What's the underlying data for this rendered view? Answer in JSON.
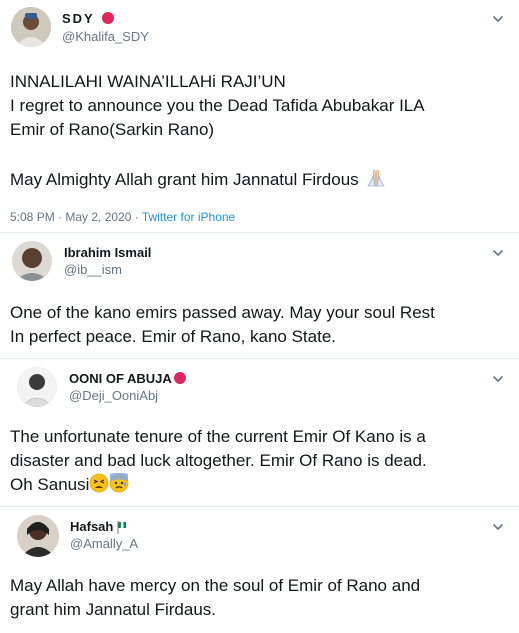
{
  "tweets": [
    {
      "name": "SDY",
      "handle": "@Khalifa_SDY",
      "lines": [
        "INNALILAHI WAINA’ILLAHi RAJI’UN",
        "I regret to announce you the Dead Tafida Abubakar ILA",
        "Emir of Rano(Sarkin Rano)",
        "",
        "May Almighty Allah grant him Jannatul Firdous"
      ],
      "timestamp": "5:08 PM · May 2, 2020 · ",
      "source": "Twitter for iPhone",
      "emoji": [
        "folded-hands-emoji"
      ],
      "badge": "red-circle-emoji"
    },
    {
      "name": "Ibrahim Ismail",
      "handle": "@ib__ism",
      "lines": [
        "One of the kano emirs passed away. May your soul Rest",
        "In perfect peace. Emir of Rano, kano State."
      ]
    },
    {
      "name": "OONI OF ABUJA",
      "handle": "@Deji_OoniAbj",
      "lines": [
        "The unfortunate tenure of the current Emir Of Kano is a",
        "disaster and bad luck altogether. Emir Of Rano is dead.",
        "Oh Sanusi"
      ],
      "badge": "red-circle-emoji",
      "emoji": [
        "weary-face-emoji",
        "anxious-face-sweat-emoji"
      ]
    },
    {
      "name": "Hafsah",
      "handle": "@Amally_A",
      "lines": [
        "May Allah have mercy on the soul of Emir of Rano and",
        "grant him Jannatul Firdaus."
      ],
      "badge": "nigeria-flag-emoji"
    }
  ],
  "colors": {
    "text": "#14171a",
    "secondary": "#657786",
    "link": "#1b95e0",
    "divider": "#e6ecf0",
    "badge_red": "#e0245e"
  }
}
